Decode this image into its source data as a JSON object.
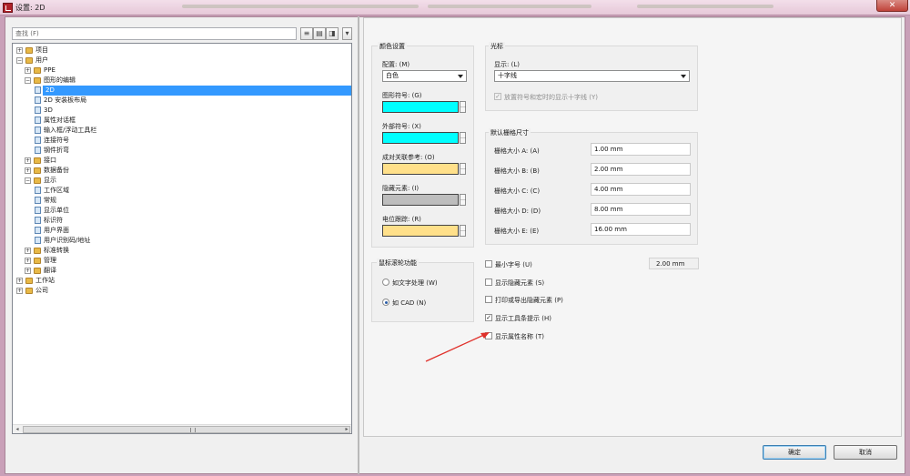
{
  "window": {
    "title": "设置: 2D",
    "close_icon": "✕"
  },
  "search": {
    "placeholder": "查找 (F)"
  },
  "toolbar": {
    "btn1": "≡",
    "btn2": "▤",
    "btn3": "◨",
    "btn4": "▾"
  },
  "tree": {
    "items": [
      {
        "label": "项目",
        "level": 0,
        "type": "folder",
        "expander": "+"
      },
      {
        "label": "用户",
        "level": 0,
        "type": "folder",
        "expander": "−"
      },
      {
        "label": "PPE",
        "level": 1,
        "type": "folder",
        "expander": "+"
      },
      {
        "label": "图形的编辑",
        "level": 1,
        "type": "folder",
        "expander": "−"
      },
      {
        "label": "2D",
        "level": 2,
        "type": "page",
        "selected": true
      },
      {
        "label": "2D 安装板布局",
        "level": 2,
        "type": "page"
      },
      {
        "label": "3D",
        "level": 2,
        "type": "page"
      },
      {
        "label": "属性对话框",
        "level": 2,
        "type": "page"
      },
      {
        "label": "输入框/浮动工具栏",
        "level": 2,
        "type": "page"
      },
      {
        "label": "连接符号",
        "level": 2,
        "type": "page"
      },
      {
        "label": "钢件折弯",
        "level": 2,
        "type": "page"
      },
      {
        "label": "接口",
        "level": 1,
        "type": "folder",
        "expander": "+"
      },
      {
        "label": "数据备份",
        "level": 1,
        "type": "folder",
        "expander": "+"
      },
      {
        "label": "显示",
        "level": 1,
        "type": "folder",
        "expander": "−"
      },
      {
        "label": "工作区域",
        "level": 2,
        "type": "page"
      },
      {
        "label": "常规",
        "level": 2,
        "type": "page"
      },
      {
        "label": "显示单位",
        "level": 2,
        "type": "page"
      },
      {
        "label": "标识符",
        "level": 2,
        "type": "page"
      },
      {
        "label": "用户界面",
        "level": 2,
        "type": "page"
      },
      {
        "label": "用户识别码/地址",
        "level": 2,
        "type": "page"
      },
      {
        "label": "标准转换",
        "level": 1,
        "type": "folder",
        "expander": "+"
      },
      {
        "label": "管理",
        "level": 1,
        "type": "folder",
        "expander": "+"
      },
      {
        "label": "翻译",
        "level": 1,
        "type": "folder",
        "expander": "+"
      },
      {
        "label": "工作站",
        "level": 0,
        "type": "folder",
        "expander": "+"
      },
      {
        "label": "公司",
        "level": 0,
        "type": "folder",
        "expander": "+"
      }
    ],
    "scroll_left": "◂",
    "scroll_right": "▸",
    "scroll_grip": "|||"
  },
  "color_settings": {
    "title": "颜色设置",
    "scheme_label": "配置: (M)",
    "scheme_value": "白色",
    "symbols_label": "图形符号: (G)",
    "symbols_color": "#00ffff",
    "external_label": "外部符号: (X)",
    "external_color": "#00ffff",
    "crossref_label": "成对关联参考: (O)",
    "crossref_color": "#ffe08a",
    "hidden_label": "隐藏元素: (I)",
    "hidden_color": "#bdbdbd",
    "potential_label": "电位跟踪: (R)",
    "potential_color": "#ffe08a",
    "more_button": "…"
  },
  "cursor": {
    "title": "光标",
    "display_label": "显示: (L)",
    "display_value": "十字线",
    "crosshair_option": "放置符号和宏时的显示十字线 (Y)",
    "crosshair_check": "✓"
  },
  "grid": {
    "title": "默认栅格尺寸",
    "rows": [
      {
        "label": "栅格大小 A: (A)",
        "value": "1.00 mm"
      },
      {
        "label": "栅格大小 B: (B)",
        "value": "2.00 mm"
      },
      {
        "label": "栅格大小 C: (C)",
        "value": "4.00 mm"
      },
      {
        "label": "栅格大小 D: (D)",
        "value": "8.00 mm"
      },
      {
        "label": "栅格大小 E: (E)",
        "value": "16.00 mm"
      }
    ]
  },
  "wheel": {
    "title": "鼠标滚轮功能",
    "option1": "如文字处理 (W)",
    "option2": "如 CAD (N)"
  },
  "options": {
    "min_font_label": "最小字号 (U)",
    "min_font_value": "2.00 mm",
    "show_hidden": "显示隐藏元素 (S)",
    "print_hidden": "打印或导出隐藏元素 (P)",
    "show_tooltips": "显示工具条提示 (H)",
    "show_tooltips_check": "✓",
    "show_prop_names": "显示属性名称 (T)"
  },
  "buttons": {
    "ok": "确定",
    "cancel": "取消"
  },
  "annotation": {
    "arrow_color": "#e0302a"
  }
}
